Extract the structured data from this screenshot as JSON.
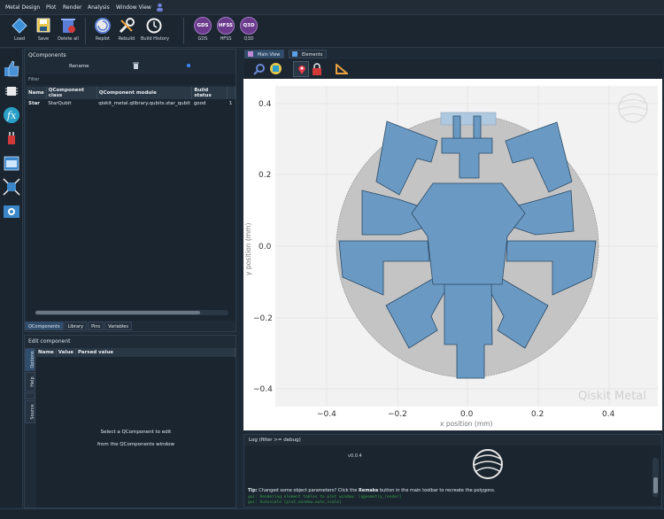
{
  "menubar": [
    "Metal Design",
    "Plot",
    "Render",
    "Analysis",
    "Window View"
  ],
  "toolbar": {
    "buttons": [
      {
        "name": "load",
        "label": "Load"
      },
      {
        "name": "save",
        "label": "Save"
      },
      {
        "name": "delete-all",
        "label": "Delete all"
      },
      {
        "name": "replot",
        "label": "Replot"
      },
      {
        "name": "rebuild",
        "label": "Rebuild"
      },
      {
        "name": "build-history",
        "label": "Build History"
      }
    ],
    "renderers": [
      {
        "name": "gds",
        "badge": "GDS",
        "label": "GDS"
      },
      {
        "name": "hfss",
        "badge": "HFSS",
        "label": "HFSS"
      },
      {
        "name": "q3d",
        "badge": "Q3D",
        "label": "Q3D"
      }
    ]
  },
  "qcomponents": {
    "title": "QComponents",
    "rename_label": "Rename",
    "filter_placeholder": "Filter",
    "columns": [
      "Name",
      "QComponent class",
      "QComponent module",
      "Build status",
      ""
    ],
    "rows": [
      {
        "name": "Star",
        "class": "StarQubit",
        "module": "qiskit_metal.qlibrary.qubits.star_qubit",
        "status": "good",
        "extra": "1"
      }
    ],
    "tabs": [
      "QComponents",
      "Library",
      "Pins",
      "Variables"
    ]
  },
  "edit_component": {
    "title": "Edit component",
    "columns": [
      "Name",
      "Value",
      "Parsed value"
    ],
    "side_tabs": [
      "Options",
      "Help",
      "Source"
    ],
    "message_line1": "Select a QComponent to edit",
    "message_line2": "from the QComponents window"
  },
  "plot": {
    "tabs": [
      "Main View",
      "Elements"
    ],
    "watermark": "Qiskit Metal",
    "xlabel": "x position (mm)",
    "ylabel": "y position (mm)",
    "xticks": [
      "−0.4",
      "−0.2",
      "0.0",
      "0.2",
      "0.4"
    ],
    "yticks": [
      "0.4",
      "0.2",
      "0.0",
      "−0.2",
      "−0.4"
    ]
  },
  "log": {
    "title": "Log  (filter >= debug)",
    "version": "v0.0.4",
    "tip_prefix": "Tip:",
    "tip_text": " Changed some object parameters? Click the ",
    "tip_bold": "Remake",
    "tip_suffix": " button in the main toolbar to recreate the polygons.",
    "line1": "gui: Rendering element tables to plot window: [qgeometry_render]",
    "line2": "gui: Autoscale [plot_window.auto_scale]"
  },
  "colors": {
    "accent": "#2f4d6d",
    "qubit": "#6a9ac4",
    "ground": "#c4c4c4"
  }
}
